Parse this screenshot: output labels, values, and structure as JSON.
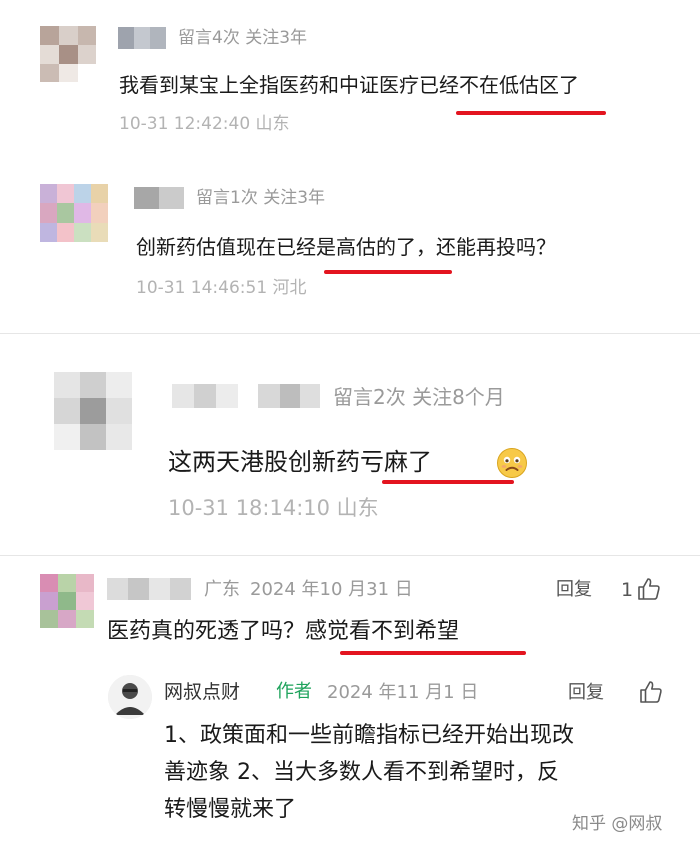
{
  "comment1": {
    "meta": "留言4次 关注3年",
    "text": "我看到某宝上全指医药和中证医疗已经不在低估区了",
    "time": "10-31 12:42:40 山东"
  },
  "comment2": {
    "meta": "留言1次 关注3年",
    "text": "创新药估值现在已经是高估的了，还能再投吗？",
    "time": "10-31 14:46:51 河北"
  },
  "comment3": {
    "meta": "留言2次 关注8个月",
    "text": "这两天港股创新药亏麻了",
    "time": "10-31 18:14:10 山东"
  },
  "comment4": {
    "location": "广东",
    "date": "2024 年10 月31 日",
    "reply_label": "回复",
    "like_count": "1",
    "text_plain": "医药真的死透了吗？",
    "text_highlight": "感觉看不到希望"
  },
  "reply": {
    "name": "网叔点财",
    "author_badge": "作者",
    "date": "2024 年11 月1 日",
    "reply_label": "回复",
    "line1": "1、政策面和一些前瞻指标已经开始出现改",
    "line2": "善迹象 2、当大多数人看不到希望时，反",
    "line3": "转慢慢就来了"
  },
  "watermark": "知乎 @网叔",
  "colors": {
    "highlight_underline": "#e3141f",
    "author_badge": "#1fa35c",
    "meta_gray": "#9a9a9a"
  },
  "icons": [
    "thumbs-up-icon",
    "sad-emoji-icon"
  ]
}
